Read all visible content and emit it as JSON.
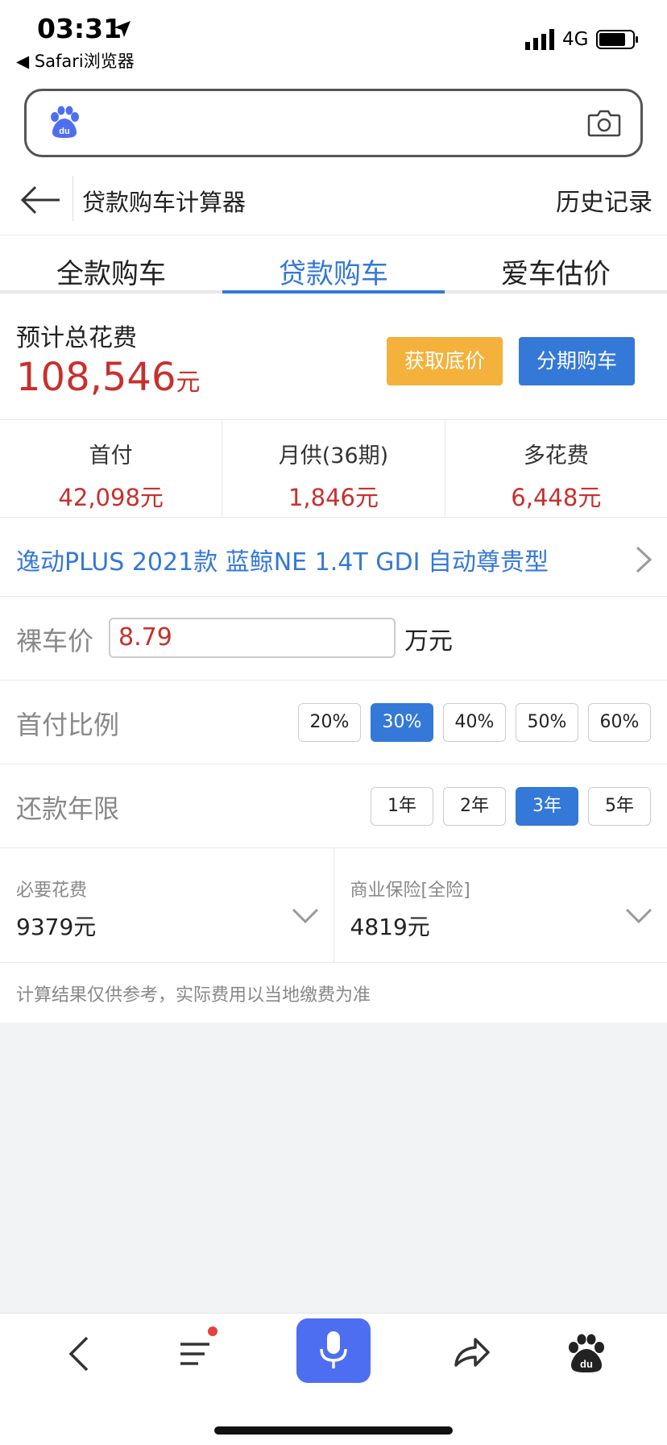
{
  "status_bar": {
    "time": "03:31",
    "back_app": "◀ Safari浏览器",
    "network": "4G"
  },
  "search": {
    "placeholder": ""
  },
  "header": {
    "title": "贷款购车计算器",
    "history": "历史记录"
  },
  "tabs": [
    {
      "label": "全款购车",
      "active": false
    },
    {
      "label": "贷款购车",
      "active": true
    },
    {
      "label": "爱车估价",
      "active": false
    }
  ],
  "summary": {
    "label": "预计总花费",
    "amount": "108,546",
    "unit": "元",
    "btn_price": "获取底价",
    "btn_installment": "分期购车"
  },
  "stats": [
    {
      "key": "首付",
      "value": "42,098元"
    },
    {
      "key": "月供(36期)",
      "value": "1,846元"
    },
    {
      "key": "多花费",
      "value": "6,448元"
    }
  ],
  "model": {
    "name": "逸动PLUS 2021款 蓝鲸NE 1.4T GDI 自动尊贵型"
  },
  "price": {
    "label": "裸车价",
    "value": "8.79",
    "unit": "万元"
  },
  "down_payment": {
    "label": "首付比例",
    "options": [
      "20%",
      "30%",
      "40%",
      "50%",
      "60%"
    ],
    "selected": "30%"
  },
  "term": {
    "label": "还款年限",
    "options": [
      "1年",
      "2年",
      "3年",
      "5年"
    ],
    "selected": "3年"
  },
  "fees": [
    {
      "key": "必要花费",
      "value": "9379元"
    },
    {
      "key": "商业保险[全险]",
      "value": "4819元"
    }
  ],
  "note": "计算结果仅供参考，实际费用以当地缴费为准",
  "colors": {
    "accent": "#3478d8",
    "price_red": "#c8302c",
    "orange": "#f4b13b",
    "baidu_blue": "#4e6ef2"
  }
}
